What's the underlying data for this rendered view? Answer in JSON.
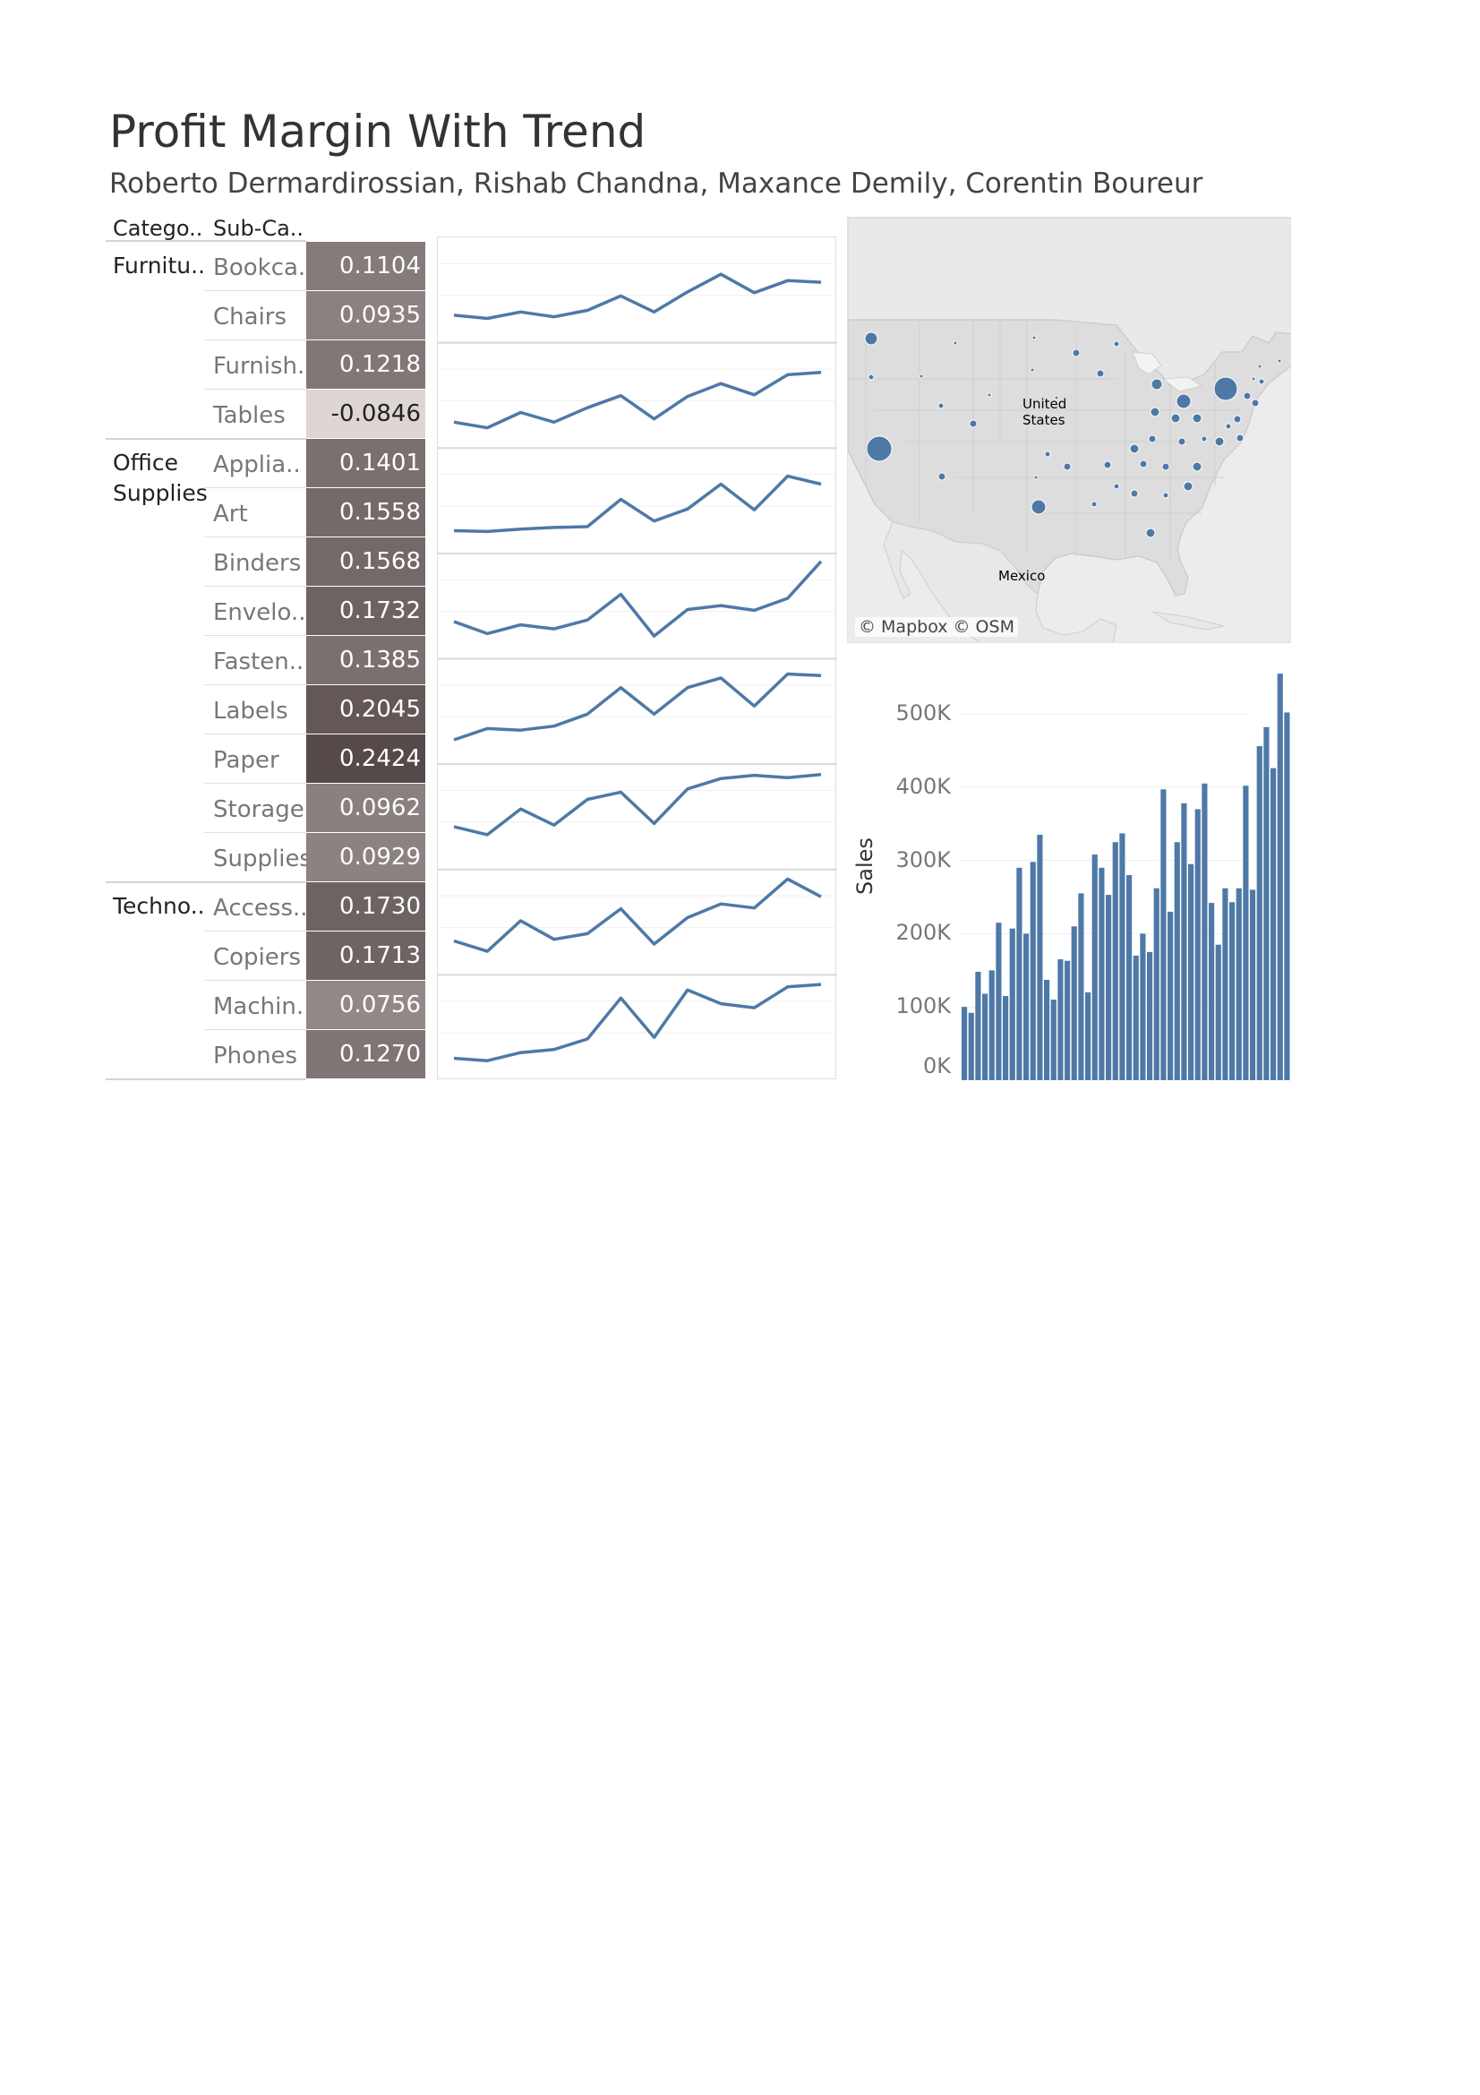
{
  "header": {
    "title": "Profit Margin With Trend",
    "subtitle": "Roberto Dermardirossian, Rishab Chandna, Maxance Demily, Corentin Boureur"
  },
  "table": {
    "col_category": "Catego..",
    "col_subcategory": "Sub-Ca..",
    "categories": [
      {
        "label": "Furnitu..",
        "rows": [
          {
            "sub": "Bookca..",
            "value": "0.1104"
          },
          {
            "sub": "Chairs",
            "value": "0.0935"
          },
          {
            "sub": "Furnish..",
            "value": "0.1218"
          },
          {
            "sub": "Tables",
            "value": "-0.0846"
          }
        ]
      },
      {
        "label": "Office\nSupplies",
        "rows": [
          {
            "sub": "Applia..",
            "value": "0.1401"
          },
          {
            "sub": "Art",
            "value": "0.1558"
          },
          {
            "sub": "Binders",
            "value": "0.1568"
          },
          {
            "sub": "Envelo..",
            "value": "0.1732"
          },
          {
            "sub": "Fasten..",
            "value": "0.1385"
          },
          {
            "sub": "Labels",
            "value": "0.2045"
          },
          {
            "sub": "Paper",
            "value": "0.2424"
          },
          {
            "sub": "Storage",
            "value": "0.0962"
          },
          {
            "sub": "Supplies",
            "value": "0.0929"
          }
        ]
      },
      {
        "label": "Techno..",
        "rows": [
          {
            "sub": "Access..",
            "value": "0.1730"
          },
          {
            "sub": "Copiers",
            "value": "0.1713"
          },
          {
            "sub": "Machin..",
            "value": "0.0756"
          },
          {
            "sub": "Phones",
            "value": "0.1270"
          }
        ]
      }
    ]
  },
  "map": {
    "credit": "© Mapbox © OSM",
    "country_labels": [
      "United",
      "States",
      "Mexico"
    ],
    "point_color": "#4e79a7"
  },
  "colors": {
    "line": "#4e79a7",
    "bar": "#4e79a7",
    "cell_scale": [
      "#ddd6d3",
      "#55494a"
    ]
  },
  "chart_data": [
    {
      "type": "line",
      "description_free": true,
      "panels": [
        {
          "values": [
            1.2,
            0.8,
            1.6,
            1.0,
            1.8,
            3.6,
            1.6,
            4.1,
            6.3,
            4.0,
            5.5,
            5.3
          ]
        },
        {
          "values": [
            1.0,
            0.3,
            2.2,
            1.0,
            2.8,
            4.3,
            1.4,
            4.2,
            5.8,
            4.4,
            6.9,
            7.2
          ]
        },
        {
          "values": [
            0.6,
            0.5,
            0.8,
            1.0,
            1.1,
            4.5,
            1.8,
            3.3,
            6.4,
            3.2,
            7.4,
            6.4
          ]
        },
        {
          "values": [
            2.4,
            0.9,
            2.0,
            1.5,
            2.6,
            5.8,
            0.6,
            3.9,
            4.4,
            3.8,
            5.3,
            9.9
          ]
        },
        {
          "values": [
            0.8,
            2.2,
            2.0,
            2.5,
            4.0,
            7.3,
            4.0,
            7.3,
            8.5,
            5.0,
            9.0,
            8.8
          ]
        },
        {
          "values": [
            3.1,
            2.1,
            5.3,
            3.3,
            6.5,
            7.4,
            3.5,
            7.8,
            9.1,
            9.5,
            9.2,
            9.6
          ]
        },
        {
          "values": [
            2.0,
            0.7,
            4.5,
            2.2,
            2.9,
            6.0,
            1.6,
            4.9,
            6.6,
            6.1,
            9.7,
            7.5
          ]
        },
        {
          "values": [
            0.5,
            0.2,
            1.2,
            1.6,
            2.9,
            8.0,
            3.1,
            9.0,
            7.3,
            6.8,
            9.4,
            9.7
          ]
        }
      ]
    },
    {
      "type": "bar",
      "ylabel": "Sales",
      "ylim": [
        0,
        560000
      ],
      "yticks": [
        0,
        100000,
        200000,
        300000,
        400000,
        500000
      ],
      "ytick_labels": [
        "0K",
        "100K",
        "200K",
        "300K",
        "400K",
        "500K"
      ],
      "values": [
        100000,
        92000,
        148000,
        118000,
        150000,
        215000,
        115000,
        207000,
        290000,
        200000,
        298000,
        335000,
        137000,
        110000,
        165000,
        163000,
        210000,
        255000,
        120000,
        308000,
        290000,
        253000,
        325000,
        337000,
        280000,
        170000,
        200000,
        175000,
        262000,
        397000,
        230000,
        325000,
        378000,
        295000,
        370000,
        405000,
        242000,
        185000,
        262000,
        243000,
        262000,
        402000,
        260000,
        456000,
        482000,
        426000,
        555000,
        502000
      ]
    }
  ]
}
